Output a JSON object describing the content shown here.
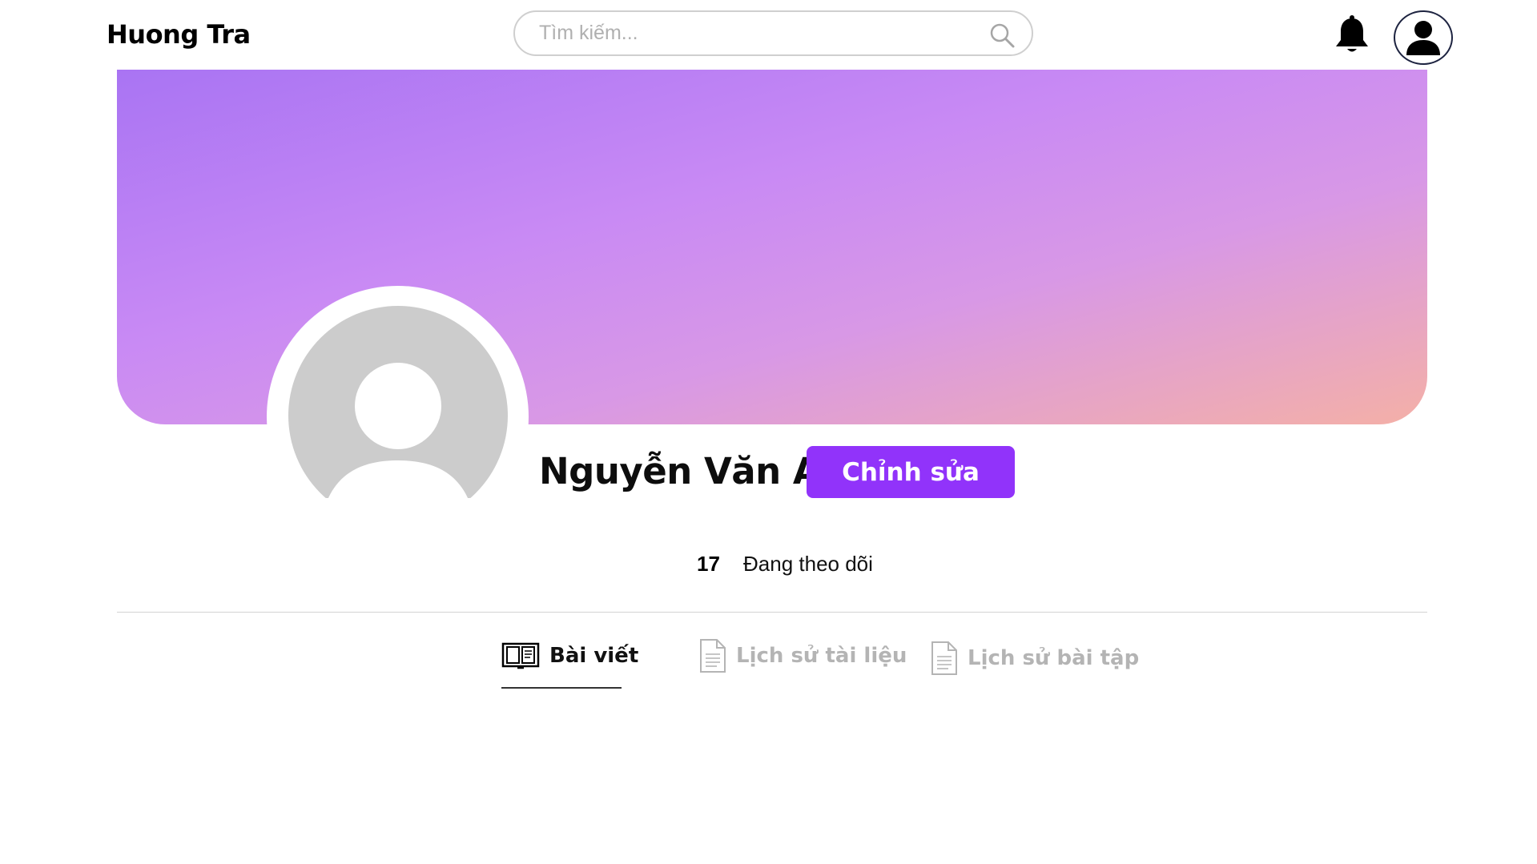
{
  "header": {
    "brand": "Huong Tra",
    "search_placeholder": "Tìm kiếm...",
    "search_icon": "search-icon",
    "notification_icon": "bell-icon",
    "account_icon": "user-icon"
  },
  "cover": {
    "gradient_start": "#a974f3",
    "gradient_end": "#f4b0a7"
  },
  "profile": {
    "avatar_icon": "default-avatar-icon",
    "name": "Nguyễn Văn A",
    "edit_label": "Chỉnh sửa",
    "edit_color": "#9133fa"
  },
  "stats": {
    "following_count": "17",
    "following_label": "Đang theo dõi"
  },
  "tabs": [
    {
      "label": "Bài viết",
      "icon": "book-icon",
      "active": true
    },
    {
      "label": "Lịch sử tài liệu",
      "icon": "document-icon",
      "active": false
    },
    {
      "label": "Lịch sử bài tập",
      "icon": "document-icon",
      "active": false
    }
  ]
}
